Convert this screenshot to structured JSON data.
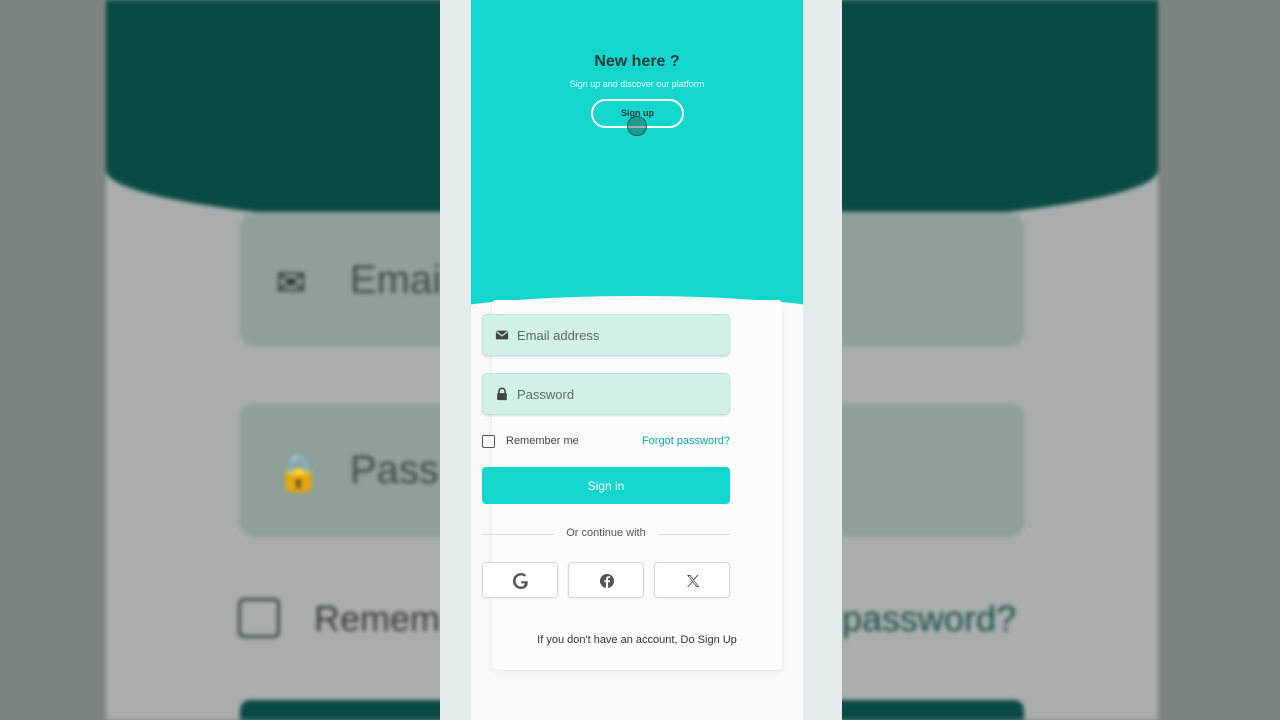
{
  "background_preview": {
    "email_text": "Emai",
    "password_text": "Pass",
    "remember_text": "Remem",
    "forgot_text": "password?"
  },
  "hero": {
    "title": "New here ?",
    "subtitle": "Sign up and discover our platform",
    "signup_button": "Sign up"
  },
  "form": {
    "email_placeholder": "Email address",
    "password_placeholder": "Password",
    "remember_label": "Remember me",
    "forgot_link": "Forgot password?",
    "signin_button": "Sign in"
  },
  "divider_text": "Or continue with",
  "social": [
    {
      "name": "google",
      "icon": "google-icon"
    },
    {
      "name": "facebook",
      "icon": "facebook-icon"
    },
    {
      "name": "x",
      "icon": "x-icon"
    }
  ],
  "footer": {
    "text": "If you don't have an account,",
    "link": "Do Sign Up"
  },
  "colors": {
    "accent": "#13d7cd",
    "field_bg": "#cff1e7",
    "link": "#0aa99f"
  }
}
